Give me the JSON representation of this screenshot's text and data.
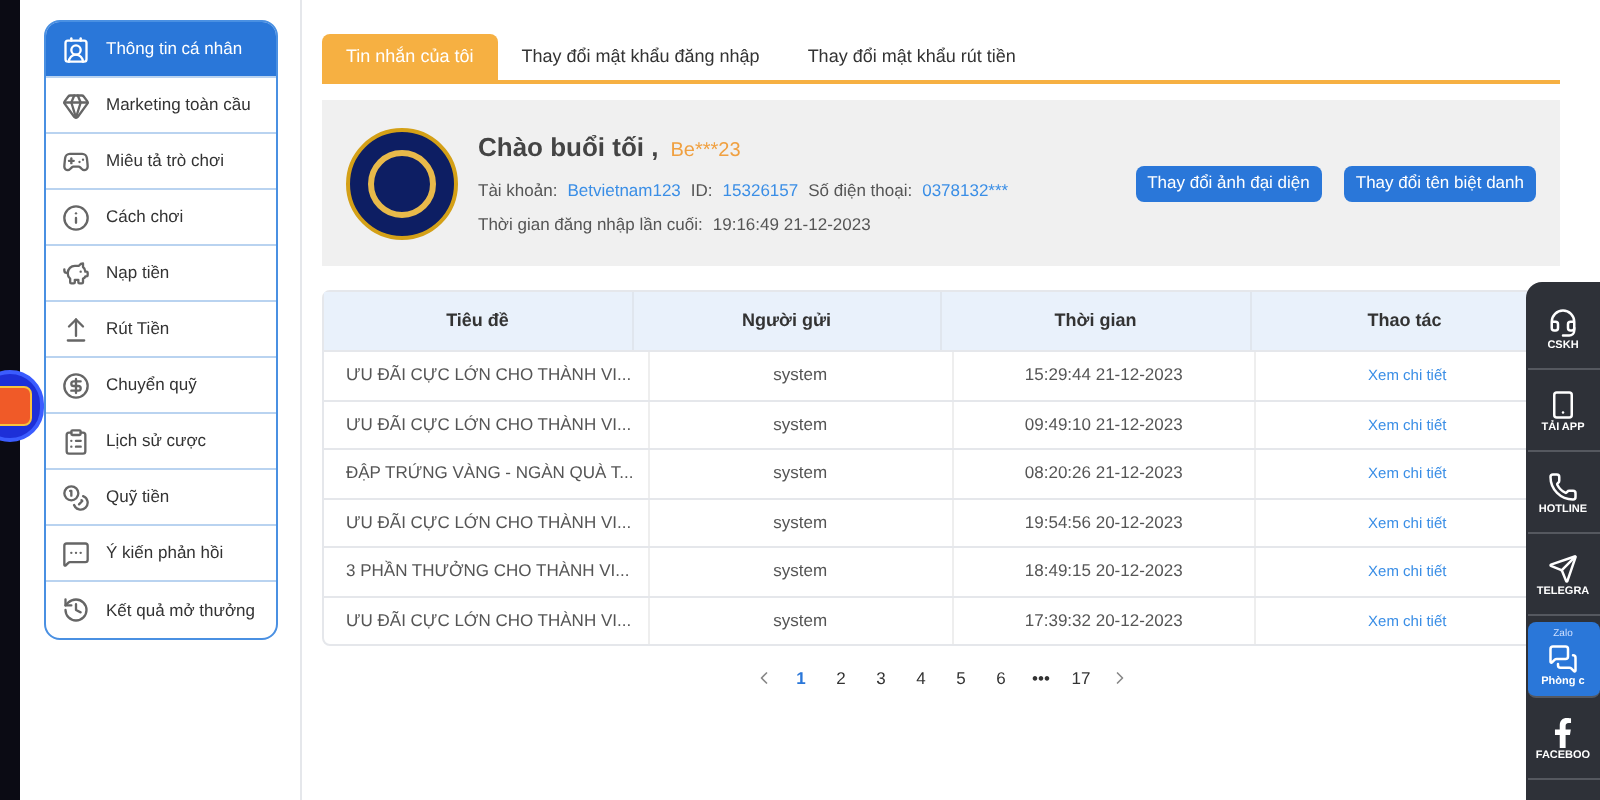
{
  "sidebar": {
    "items": [
      {
        "label": "Thông tin cá nhân",
        "selected": true
      },
      {
        "label": "Marketing toàn cầu",
        "selected": false
      },
      {
        "label": "Miêu tả trò chơi",
        "selected": false
      },
      {
        "label": "Cách chơi",
        "selected": false
      },
      {
        "label": "Nạp tiền",
        "selected": false
      },
      {
        "label": "Rút Tiền",
        "selected": false
      },
      {
        "label": "Chuyển quỹ",
        "selected": false
      },
      {
        "label": "Lịch sử cược",
        "selected": false
      },
      {
        "label": "Quỹ tiền",
        "selected": false
      },
      {
        "label": "Ý kiến phản hồi",
        "selected": false
      },
      {
        "label": "Kết quả mở thưởng",
        "selected": false
      }
    ]
  },
  "tabs": [
    {
      "label": "Tin nhắn của tôi",
      "selected": true
    },
    {
      "label": "Thay đổi mật khẩu đăng nhập",
      "selected": false
    },
    {
      "label": "Thay đổi mật khẩu rút tiền",
      "selected": false
    }
  ],
  "profile": {
    "greeting": "Chào buổi tối ,",
    "username": "Be***23",
    "account_label": "Tài khoản:",
    "account": "Betvietnam123",
    "id_label": "ID:",
    "id": "15326157",
    "phone_label": "Số điện thoại:",
    "phone": "0378132***",
    "last_login_label": "Thời gian đăng nhập lần cuối:",
    "last_login": "19:16:49 21-12-2023",
    "buttons": [
      "Thay đổi ảnh đại diện",
      "Thay đổi tên biệt danh"
    ]
  },
  "table": {
    "columns": [
      "Tiêu đề",
      "Người gửi",
      "Thời gian",
      "Thao tác"
    ],
    "rows": [
      [
        "ƯU ĐÃI CỰC LỚN CHO THÀNH VI...",
        "system",
        "15:29:44 21-12-2023",
        "Xem chi tiết"
      ],
      [
        "ƯU ĐÃI CỰC LỚN CHO THÀNH VI...",
        "system",
        "09:49:10 21-12-2023",
        "Xem chi tiết"
      ],
      [
        "ĐẬP TRỨNG VÀNG - NGÀN QUÀ T...",
        "system",
        "08:20:26 21-12-2023",
        "Xem chi tiết"
      ],
      [
        "ƯU ĐÃI CỰC LỚN CHO THÀNH VI...",
        "system",
        "19:54:56 20-12-2023",
        "Xem chi tiết"
      ],
      [
        "3 PHẦN THƯỞNG CHO THÀNH VI...",
        "system",
        "18:49:15 20-12-2023",
        "Xem chi tiết"
      ],
      [
        "ƯU ĐÃI CỰC LỚN CHO THÀNH VI...",
        "system",
        "17:39:32 20-12-2023",
        "Xem chi tiết"
      ]
    ]
  },
  "pagination": {
    "pages": [
      {
        "label": "1",
        "selected": true
      },
      {
        "label": "2",
        "selected": false
      },
      {
        "label": "3",
        "selected": false
      },
      {
        "label": "4",
        "selected": false
      },
      {
        "label": "5",
        "selected": false
      },
      {
        "label": "6",
        "selected": false
      },
      {
        "label": "•••",
        "selected": false
      },
      {
        "label": "17",
        "selected": false
      }
    ]
  },
  "float_panel": {
    "items": [
      {
        "label": "CSKH",
        "selected": false
      },
      {
        "label": "TẢI APP",
        "selected": false
      },
      {
        "label": "HOTLINE",
        "selected": false
      },
      {
        "label": "TELEGRA",
        "selected": false
      },
      {
        "label": "Phòng c",
        "badge": "Zalo",
        "selected": true
      },
      {
        "label": "FACEBOO",
        "selected": false
      }
    ]
  }
}
